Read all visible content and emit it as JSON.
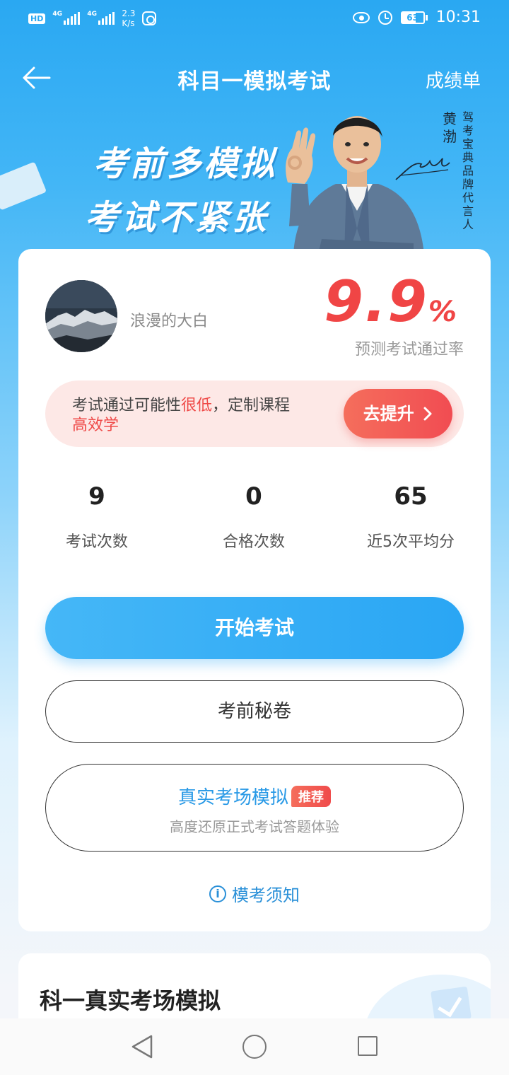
{
  "status_bar": {
    "hd": "HD",
    "net1": "4G",
    "net2": "4G",
    "speed_value": "2.3",
    "speed_unit": "K/s",
    "battery": "63",
    "time": "10:31"
  },
  "nav": {
    "title": "科目一模拟考试",
    "report": "成绩单"
  },
  "banner": {
    "slogan_line1": "考前多模拟",
    "slogan_line2": "考试不紧张",
    "endorser_name": "黄渤",
    "endorser_title": "驾考宝典品牌代言人"
  },
  "profile": {
    "username": "浪漫的大白",
    "pass_rate_value": "9.9",
    "pass_rate_unit": "%",
    "pass_rate_label": "预测考试通过率"
  },
  "promo": {
    "text_before": "考试通过可能性",
    "text_highlight": "很低",
    "text_after": "，定制课程",
    "text_line2": "高效学",
    "button_label": "去提升"
  },
  "stats": [
    {
      "value": "9",
      "label": "考试次数"
    },
    {
      "value": "0",
      "label": "合格次数"
    },
    {
      "value": "65",
      "label": "近5次平均分"
    }
  ],
  "actions": {
    "start_exam": "开始考试",
    "secret_paper": "考前秘卷",
    "real_exam_title": "真实考场模拟",
    "real_exam_badge": "推荐",
    "real_exam_sub": "高度还原正式考试答题体验",
    "notice": "模考须知",
    "info_glyph": "i"
  },
  "section2": {
    "title": "科一真实考场模拟"
  },
  "colors": {
    "brand_blue": "#2aa6f4",
    "alert_red": "#f04545",
    "promo_bg": "#fde8e6"
  }
}
